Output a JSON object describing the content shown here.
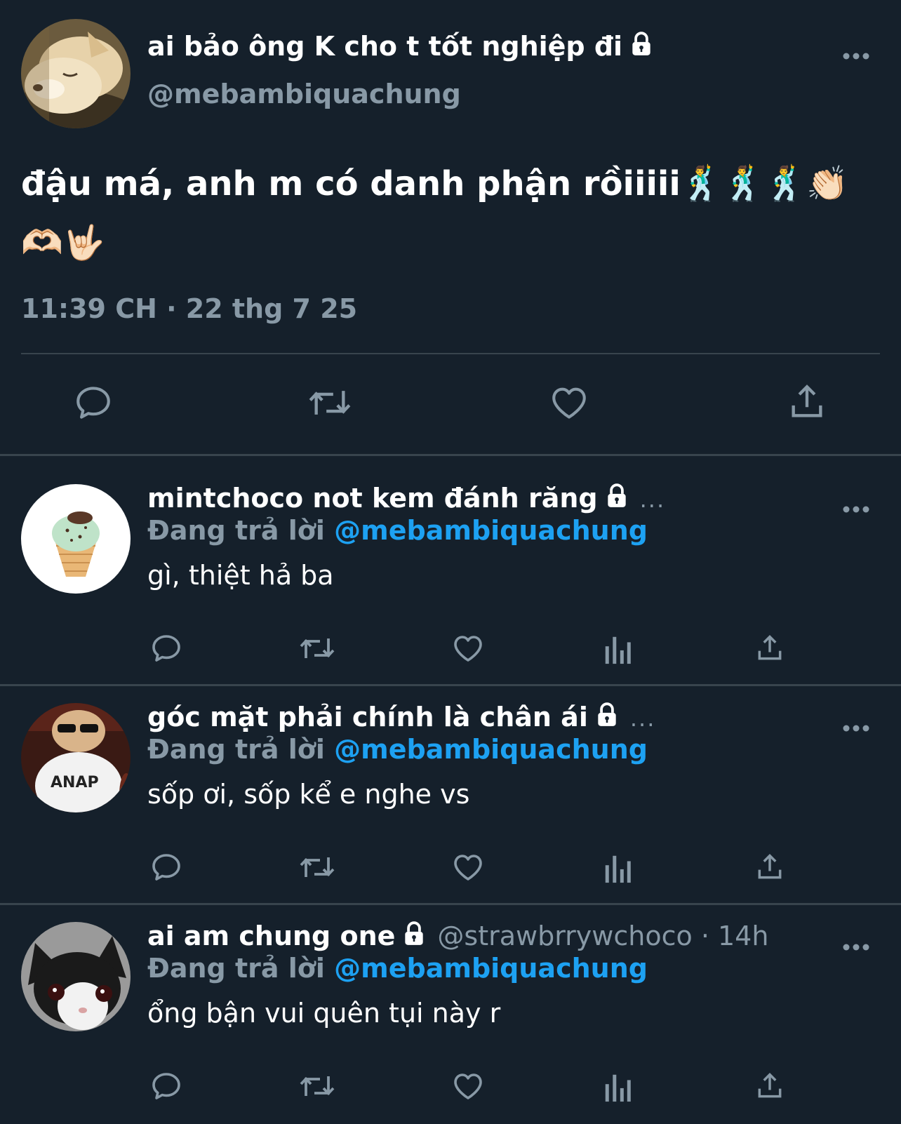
{
  "main_tweet": {
    "display_name": "ai bảo ông K cho t tốt nghiệp đi",
    "handle": "@mebambiquachung",
    "text_line1": "đậu má, anh m có danh phận rồiiiii",
    "emoji_line1": "🕺🕺🕺👏🏻",
    "emoji_line2": "🫶🏻🤟🏻",
    "timestamp": "11:39 CH · 22 thg 7 25",
    "avatar_icon": "sleeping-shiba-dog-avatar"
  },
  "replies": [
    {
      "display_name": "mintchoco not kem đánh răng",
      "trailing": "...",
      "replying_label": "Đang trả lời",
      "mention": "@mebambiquachung",
      "text": "gì, thiệt hả ba",
      "avatar_icon": "mint-choco-ice-cream-avatar"
    },
    {
      "display_name": "góc mặt phải chính là chân ái",
      "trailing": "...",
      "replying_label": "Đang trả lời",
      "mention": "@mebambiquachung",
      "text": "sốp ơi, sốp kể e nghe vs",
      "avatar_icon": "kid-sunglasses-avatar"
    },
    {
      "display_name": "ai am chung one",
      "meta": "@strawbrrywchoco · 14h",
      "replying_label": "Đang trả lời",
      "mention": "@mebambiquachung",
      "text": "ổng bận vui quên tụi này r",
      "avatar_icon": "black-white-cat-avatar"
    }
  ],
  "colors": {
    "background": "#15202b",
    "secondary_text": "#8899a6",
    "mention": "#1da1f2",
    "divider": "#38444d"
  }
}
